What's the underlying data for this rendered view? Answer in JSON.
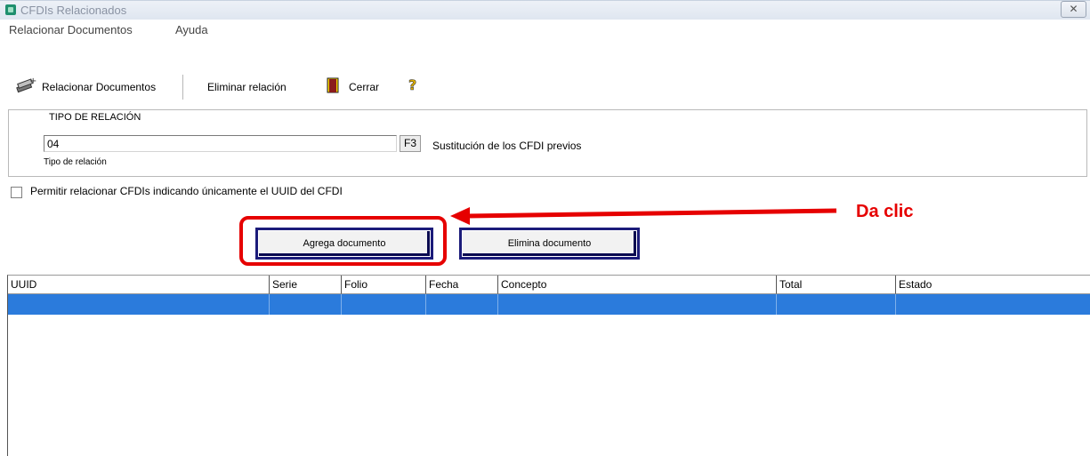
{
  "window": {
    "title": "CFDIs Relacionados",
    "close_label": "✕"
  },
  "menu": {
    "items": [
      "Relacionar Documentos",
      "Ayuda"
    ]
  },
  "toolbar": {
    "relacionar_label": "Relacionar Documentos",
    "eliminar_label": "Eliminar relación",
    "cerrar_label": "Cerrar",
    "help_icon": "help-icon"
  },
  "relacion": {
    "group_title": "TIPO DE RELACIÓN",
    "tipo_value": "04",
    "f3_label": "F3",
    "tipo_description": "Sustitución de los CFDI previos",
    "tipo_field_label": "Tipo de relación"
  },
  "options": {
    "uuid_only_label": "Permitir relacionar CFDIs indicando únicamente el UUID del CFDI",
    "uuid_only_checked": false
  },
  "buttons": {
    "agrega_label": "Agrega documento",
    "elimina_label": "Elimina documento"
  },
  "annotation": {
    "callout_text": "Da clic",
    "color": "#e60000"
  },
  "table": {
    "columns": [
      "UUID",
      "Serie",
      "Folio",
      "Fecha",
      "Concepto",
      "Total",
      "Estado"
    ],
    "rows": [
      [
        "",
        "",
        "",
        "",
        "",
        "",
        ""
      ]
    ],
    "selection_color": "#2b7bdc"
  }
}
